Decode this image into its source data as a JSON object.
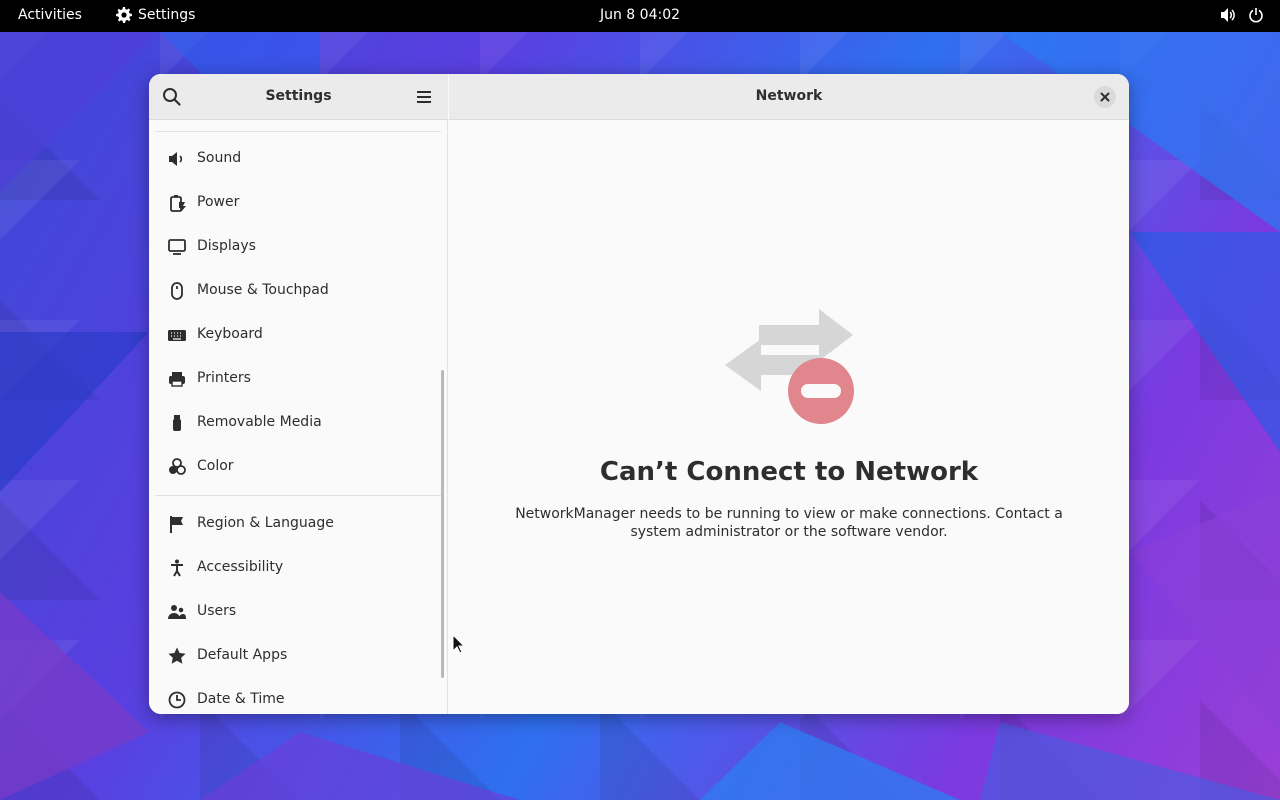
{
  "topbar": {
    "activities": "Activities",
    "app_name": "Settings",
    "clock": "Jun 8  04:02",
    "icons": [
      "gear-icon",
      "volume-icon",
      "power-icon"
    ]
  },
  "sidebar": {
    "title": "Settings",
    "items": [
      {
        "label": "Sound",
        "icon": "speaker-icon"
      },
      {
        "label": "Power",
        "icon": "battery-icon"
      },
      {
        "label": "Displays",
        "icon": "monitor-icon"
      },
      {
        "label": "Mouse & Touchpad",
        "icon": "mouse-icon"
      },
      {
        "label": "Keyboard",
        "icon": "keyboard-icon"
      },
      {
        "label": "Printers",
        "icon": "printer-icon"
      },
      {
        "label": "Removable Media",
        "icon": "usb-icon"
      },
      {
        "label": "Color",
        "icon": "color-icon"
      },
      {
        "label": "Region & Language",
        "icon": "flag-icon"
      },
      {
        "label": "Accessibility",
        "icon": "accessibility-icon"
      },
      {
        "label": "Users",
        "icon": "users-icon"
      },
      {
        "label": "Default Apps",
        "icon": "star-icon"
      },
      {
        "label": "Date & Time",
        "icon": "clock-icon"
      }
    ]
  },
  "main": {
    "title": "Network",
    "status_title": "Can’t Connect to Network",
    "status_description": "NetworkManager needs to be running to view or make connections. Contact a system administrator or the software vendor."
  },
  "colors": {
    "error_badge": "#e0868c",
    "arrows": "#d6d6d6",
    "window_bg": "#fafafa",
    "header_bg": "#ebebeb"
  }
}
